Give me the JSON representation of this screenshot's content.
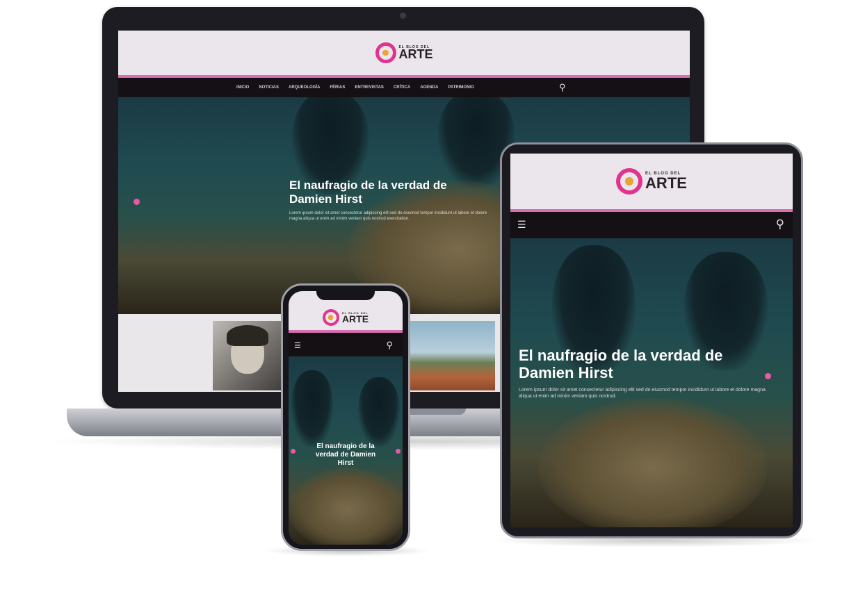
{
  "brand": {
    "logo_small_text": "EL BLOG DEL",
    "logo_big_text": "ARTE",
    "accent_color": "#d86fb2",
    "ring_color": "#e0348f"
  },
  "laptop": {
    "nav_items": [
      "INICIO",
      "NOTICIAS",
      "ARQUEOLOGÍA",
      "FÉRIAS",
      "ENTREVISTAS",
      "CRÍTICA",
      "AGENDA",
      "PATRIMONIO"
    ],
    "search_icon": "search-icon",
    "hero": {
      "title_line1": "El naufragio de la verdad de",
      "title_line2": "Damien Hirst",
      "excerpt": "Lorem ipsum dolor sit amet consectetur adipiscing elit sed do eiusmod tempor incididunt ut labore et dolore magna aliqua ut enim ad minim veniam quis nostrud exercitation."
    }
  },
  "tablet": {
    "menu_icon": "menu-icon",
    "search_icon": "search-icon",
    "hero": {
      "title_line1": "El naufragio de la verdad de",
      "title_line2": "Damien Hirst",
      "excerpt": "Lorem ipsum dolor sit amet consectetur adipiscing elit sed do eiusmod tempor incididunt ut labore et dolore magna aliqua ut enim ad minim veniam quis nostrud."
    }
  },
  "phone": {
    "menu_icon": "menu-icon",
    "search_icon": "search-icon",
    "hero": {
      "title_line1": "El naufragio de la",
      "title_line2": "verdad de Damien",
      "title_line3": "Hirst"
    }
  }
}
